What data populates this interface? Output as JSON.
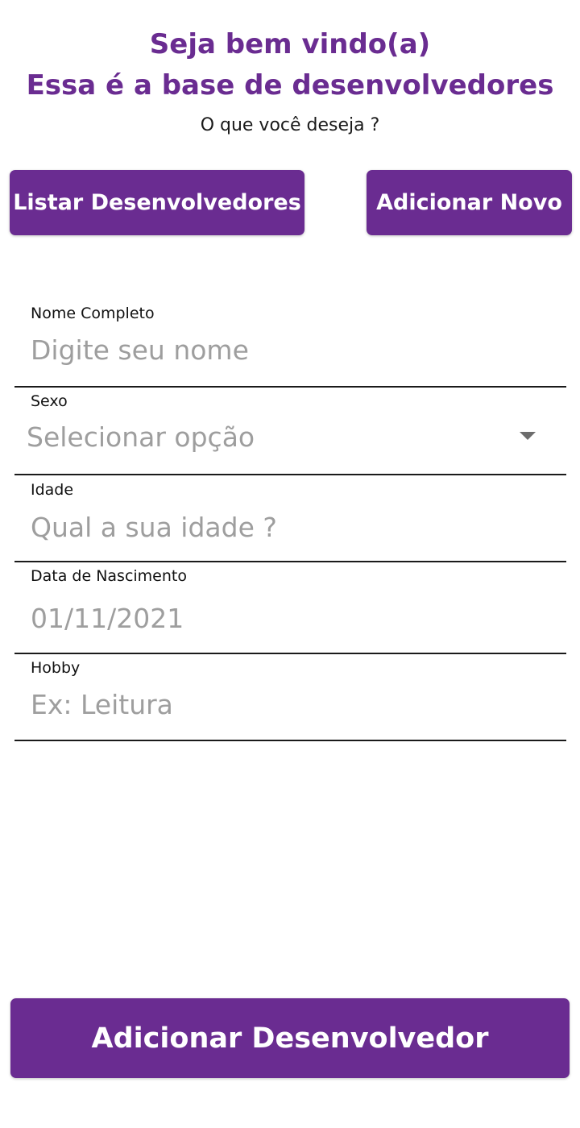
{
  "header": {
    "title_line1": "Seja bem vindo(a)",
    "title_line2": "Essa é a base de desenvolvedores",
    "subtitle": "O que você deseja ?"
  },
  "actions": {
    "list_label": "Listar Desenvolvedores",
    "new_label": "Adicionar Novo"
  },
  "form": {
    "name": {
      "label": "Nome Completo",
      "placeholder": "Digite seu nome",
      "value": ""
    },
    "sex": {
      "label": "Sexo",
      "selected": "Selecionar opção",
      "icon": "chevron-down-icon"
    },
    "age": {
      "label": "Idade",
      "placeholder": "Qual a sua idade ?",
      "value": ""
    },
    "birthdate": {
      "label": "Data de Nascimento",
      "placeholder": "01/11/2021",
      "value": ""
    },
    "hobby": {
      "label": "Hobby",
      "placeholder": "Ex: Leitura",
      "value": ""
    }
  },
  "submit": {
    "label": "Adicionar Desenvolvedor"
  },
  "colors": {
    "accent": "#6a2c91",
    "placeholder": "#9e9e9e",
    "divider": "#1a1a1a"
  }
}
